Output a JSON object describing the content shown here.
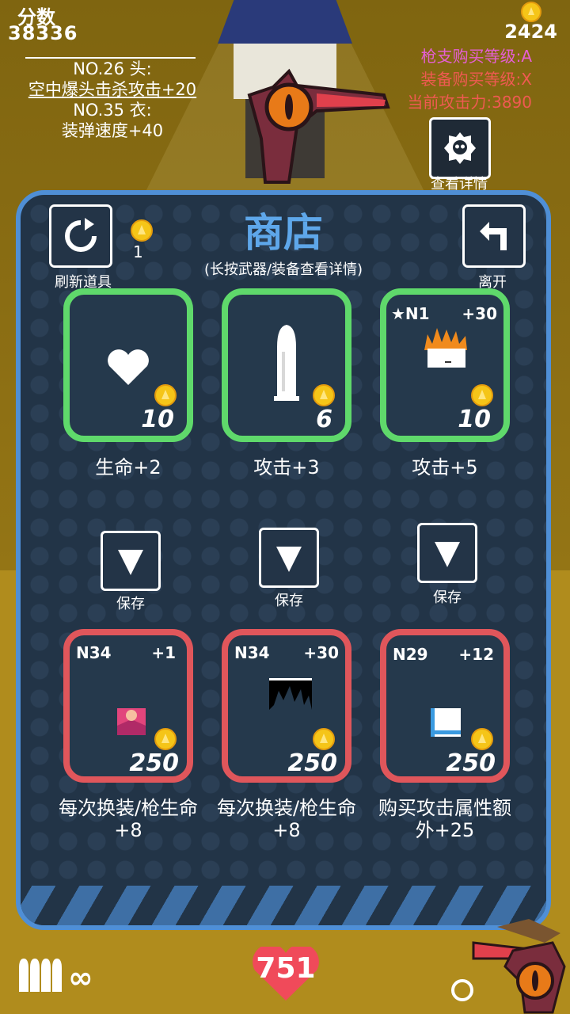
{
  "hud": {
    "score_label": "分数",
    "score": "38336",
    "info_lines": [
      "NO.26 头:",
      "空中爆头击杀攻击+20",
      "NO.35 衣:",
      "装弹速度+40"
    ],
    "coins": "2424",
    "status": [
      "枪支购买等级:A",
      "装备购买等级:X",
      "当前攻击力:3890"
    ],
    "detail_label": "查看详情"
  },
  "shop": {
    "title": "商店",
    "subtitle": "(长按武器/装备查看详情)",
    "refresh_label": "刷新道具",
    "refresh_cost": "1",
    "leave_label": "离开",
    "save_label": "保存",
    "top_items": [
      {
        "icon": "heart-icon",
        "price": "10",
        "label": "生命+2"
      },
      {
        "icon": "bullet-icon",
        "price": "6",
        "label": "攻击+3"
      },
      {
        "icon": "flame-hair-icon",
        "tag_left": "★N1",
        "tag_right": "+30",
        "price": "10",
        "label": "攻击+5"
      }
    ],
    "bottom_items": [
      {
        "icon": "pink-hat-icon",
        "tag_left": "N34",
        "tag_right": "+1",
        "price": "250",
        "label": "每次换装/枪生命+8"
      },
      {
        "icon": "black-spiky-hair-icon",
        "tag_left": "N34",
        "tag_right": "+30",
        "price": "250",
        "label": "每次换装/枪生命+8"
      },
      {
        "icon": "blue-box-icon",
        "tag_left": "N29",
        "tag_right": "+12",
        "price": "250",
        "label": "购买攻击属性额外+25"
      }
    ]
  },
  "footer": {
    "ammo": "∞",
    "hp": "751"
  },
  "colors": {
    "panel_border": "#4f8fd6",
    "panel_bg": "#223447",
    "green_card": "#5fd96b",
    "red_card": "#e0565b",
    "title": "#5ea7ea",
    "coin": "#f5c518",
    "level_a": "#e55fd3",
    "level_x": "#ef5a52"
  }
}
